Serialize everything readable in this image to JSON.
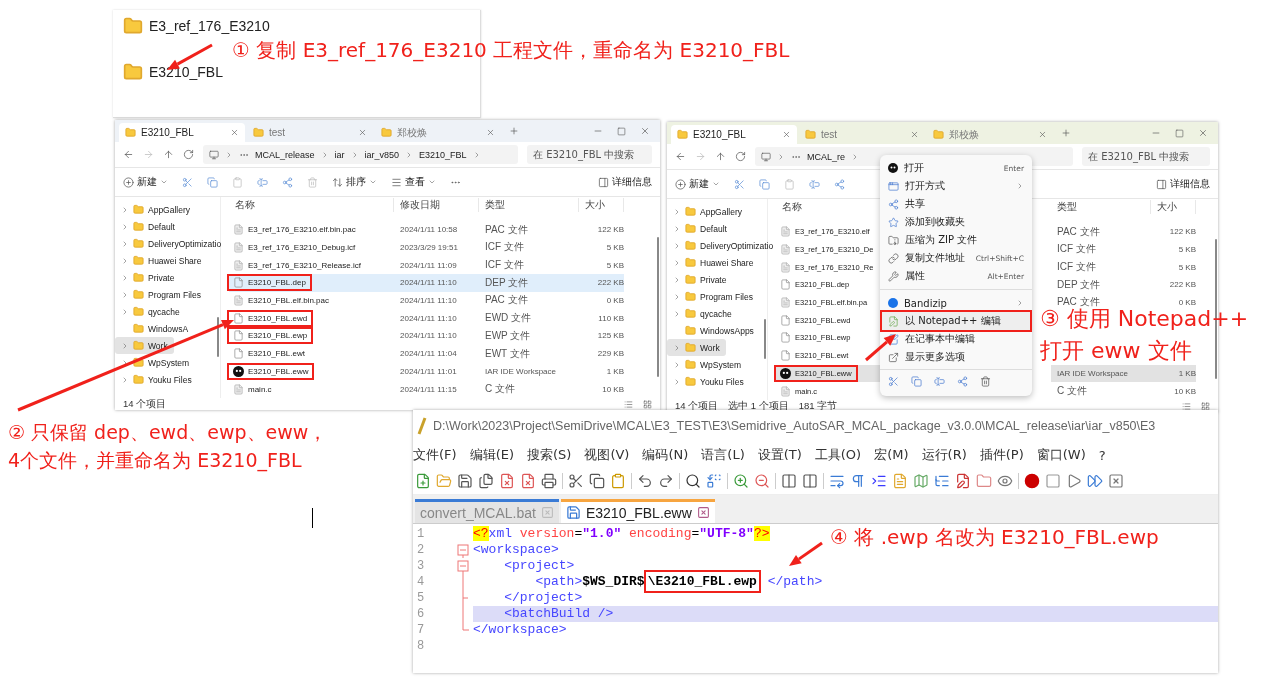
{
  "top_panel": {
    "folders": [
      {
        "name": "E3_ref_176_E3210"
      },
      {
        "name": "E3210_FBL"
      }
    ]
  },
  "annotations": [
    {
      "lines": [
        "① 复制 E3_ref_176_E3210 工程文件，重命名为 E3210_FBL"
      ]
    },
    {
      "lines": [
        "② 只保留 dep、ewd、ewp、eww，",
        "4个文件，并重命名为 E3210_FBL"
      ]
    },
    {
      "lines": [
        "③ 使用 Notepad++",
        "打开 eww 文件"
      ]
    },
    {
      "lines": [
        "④ 将 .ewp 名改为 E3210_FBL.ewp"
      ]
    }
  ],
  "explorers": [
    {
      "tabs": [
        {
          "label": "E3210_FBL",
          "selected": true
        },
        {
          "label": "test",
          "selected": false
        },
        {
          "label": "郑校焕",
          "selected": false
        }
      ],
      "breadcrumb": [
        "MCAL_release",
        "iar",
        "iar_v850",
        "E3210_FBL"
      ],
      "search": {
        "placeholder": "在 E3210_FBL 中搜索"
      },
      "toolbar": [
        {
          "kind": "new",
          "label": "新建"
        },
        {
          "kind": "cut"
        },
        {
          "kind": "copy"
        },
        {
          "kind": "paste"
        },
        {
          "kind": "rename"
        },
        {
          "kind": "share"
        },
        {
          "kind": "delete"
        },
        {
          "kind": "sort",
          "label": "排序"
        },
        {
          "kind": "view",
          "label": "查看"
        },
        {
          "kind": "more"
        }
      ],
      "details": "详细信息",
      "sidebar": [
        {
          "label": "AppGallery",
          "has_children": true,
          "selected": false
        },
        {
          "label": "Default",
          "has_children": true,
          "selected": false
        },
        {
          "label": "DeliveryOptimizatio",
          "has_children": true,
          "selected": false
        },
        {
          "label": "Huawei Share",
          "has_children": true,
          "selected": false
        },
        {
          "label": "Private",
          "has_children": true,
          "selected": false
        },
        {
          "label": "Program Files",
          "has_children": true,
          "selected": false
        },
        {
          "label": "qycache",
          "has_children": true,
          "selected": false
        },
        {
          "label": "WindowsA",
          "has_children": false,
          "selected": false
        },
        {
          "label": "Work",
          "has_children": true,
          "selected": true
        },
        {
          "label": "WpSystem",
          "has_children": true,
          "selected": false
        },
        {
          "label": "Youku Files",
          "has_children": true,
          "selected": false
        }
      ],
      "columns": [
        "名称",
        "修改日期",
        "类型",
        "大小"
      ],
      "files": [
        {
          "name": "E3_ref_176_E3210.elf.bin.pac",
          "date": "2024/1/11 10:58",
          "type": "PAC 文件",
          "size": "122 KB",
          "kind": "generic",
          "selected": false,
          "marked": false
        },
        {
          "name": "E3_ref_176_E3210_Debug.icf",
          "date": "2023/3/29 19:51",
          "type": "ICF 文件",
          "size": "5 KB",
          "kind": "generic",
          "selected": false,
          "marked": false
        },
        {
          "name": "E3_ref_176_E3210_Release.icf",
          "date": "2024/1/11 11:09",
          "type": "ICF 文件",
          "size": "5 KB",
          "kind": "generic",
          "selected": false,
          "marked": false
        },
        {
          "name": "E3210_FBL.dep",
          "date": "2024/1/11 11:10",
          "type": "DEP 文件",
          "size": "222 KB",
          "kind": "document",
          "selected": true,
          "marked": true
        },
        {
          "name": "E3210_FBL.elf.bin.pac",
          "date": "2024/1/11 11:10",
          "type": "PAC 文件",
          "size": "0 KB",
          "kind": "generic",
          "selected": false,
          "marked": false
        },
        {
          "name": "E3210_FBL.ewd",
          "date": "2024/1/11 11:10",
          "type": "EWD 文件",
          "size": "110 KB",
          "kind": "document",
          "selected": false,
          "marked": true
        },
        {
          "name": "E3210_FBL.ewp",
          "date": "2024/1/11 11:10",
          "type": "EWP 文件",
          "size": "125 KB",
          "kind": "document",
          "selected": false,
          "marked": true
        },
        {
          "name": "E3210_FBL.ewt",
          "date": "2024/1/11 11:04",
          "type": "EWT 文件",
          "size": "229 KB",
          "kind": "document",
          "selected": false,
          "marked": false
        },
        {
          "name": "E3210_FBL.eww",
          "date": "2024/1/11 11:01",
          "type": "IAR IDE Workspace",
          "size": "1 KB",
          "kind": "workspace",
          "selected": false,
          "marked": true
        },
        {
          "name": "main.c",
          "date": "2024/1/11 11:15",
          "type": "C 文件",
          "size": "10 KB",
          "kind": "generic",
          "selected": false,
          "marked": false
        }
      ],
      "status": [
        "14 个项目"
      ]
    },
    {
      "tabs": [
        {
          "label": "E3210_FBL",
          "selected": true
        },
        {
          "label": "test",
          "selected": false
        },
        {
          "label": "郑校焕",
          "selected": false
        }
      ],
      "breadcrumb": [
        "MCAL_re"
      ],
      "search": {
        "placeholder": "在 E3210_FBL 中搜索"
      },
      "toolbar": [
        {
          "kind": "new",
          "label": "新建"
        },
        {
          "kind": "cut"
        },
        {
          "kind": "copy"
        },
        {
          "kind": "paste"
        },
        {
          "kind": "rename"
        },
        {
          "kind": "share"
        }
      ],
      "details": "详细信息",
      "sidebar": [
        {
          "label": "AppGallery",
          "has_children": true,
          "selected": false
        },
        {
          "label": "Default",
          "has_children": true,
          "selected": false
        },
        {
          "label": "DeliveryOptimizatio",
          "has_children": true,
          "selected": false
        },
        {
          "label": "Huawei Share",
          "has_children": true,
          "selected": false
        },
        {
          "label": "Private",
          "has_children": true,
          "selected": false
        },
        {
          "label": "Program Files",
          "has_children": true,
          "selected": false
        },
        {
          "label": "qycache",
          "has_children": true,
          "selected": false
        },
        {
          "label": "WindowsApps",
          "has_children": false,
          "selected": false
        },
        {
          "label": "Work",
          "has_children": true,
          "selected": true
        },
        {
          "label": "WpSystem",
          "has_children": true,
          "selected": false
        },
        {
          "label": "Youku Files",
          "has_children": true,
          "selected": false
        }
      ],
      "columns": [
        "名称",
        "类型",
        "大小"
      ],
      "files": [
        {
          "name": "E3_ref_176_E3210.elf",
          "type": "PAC 文件",
          "size": "122 KB",
          "kind": "generic",
          "selected": false,
          "marked": false
        },
        {
          "name": "E3_ref_176_E3210_De",
          "type": "ICF 文件",
          "size": "5 KB",
          "kind": "generic",
          "selected": false,
          "marked": false
        },
        {
          "name": "E3_ref_176_E3210_Re",
          "type": "ICF 文件",
          "size": "5 KB",
          "kind": "generic",
          "selected": false,
          "marked": false
        },
        {
          "name": "E3210_FBL.dep",
          "type": "DEP 文件",
          "size": "222 KB",
          "kind": "document",
          "selected": false,
          "marked": false
        },
        {
          "name": "E3210_FBL.elf.bin.pa",
          "type": "PAC 文件",
          "size": "0 KB",
          "kind": "generic",
          "selected": false,
          "marked": false
        },
        {
          "name": "E3210_FBL.ewd",
          "kind": "document",
          "selected": false,
          "marked": false
        },
        {
          "name": "E3210_FBL.ewp",
          "kind": "document",
          "selected": false,
          "marked": false
        },
        {
          "name": "E3210_FBL.ewt",
          "kind": "document",
          "selected": false,
          "marked": false
        },
        {
          "name": "E3210_FBL.eww",
          "type": "IAR IDE Workspace",
          "size": "1 KB",
          "kind": "workspace",
          "selected": true,
          "marked": true
        },
        {
          "name": "main.c",
          "type": "C 文件",
          "size": "10 KB",
          "kind": "generic",
          "selected": false,
          "marked": false
        }
      ],
      "status": [
        "14 个项目",
        "选中 1 个项目",
        "181 字节"
      ],
      "context_menu": {
        "items": [
          {
            "kind": "item",
            "label": "打开",
            "shortcut": "Enter",
            "submenu": false,
            "marked": false
          },
          {
            "kind": "item",
            "label": "打开方式",
            "submenu": true,
            "marked": false
          },
          {
            "kind": "item",
            "label": "共享",
            "submenu": false,
            "marked": false
          },
          {
            "kind": "item",
            "label": "添加到收藏夹",
            "submenu": false,
            "marked": false
          },
          {
            "kind": "item",
            "label": "压缩为 ZIP 文件",
            "submenu": false,
            "marked": false
          },
          {
            "kind": "item",
            "label": "复制文件地址",
            "shortcut": "Ctrl+Shift+C",
            "submenu": false,
            "marked": false
          },
          {
            "kind": "item",
            "label": "属性",
            "shortcut": "Alt+Enter",
            "submenu": false,
            "marked": false
          },
          {
            "kind": "separator"
          },
          {
            "kind": "item",
            "label": "Bandizip",
            "submenu": true,
            "marked": false
          },
          {
            "kind": "item",
            "label": "以 Notepad++ 编辑",
            "submenu": false,
            "marked": true
          },
          {
            "kind": "item",
            "label": "在记事本中编辑",
            "submenu": false,
            "marked": false
          },
          {
            "kind": "item",
            "label": "显示更多选项",
            "submenu": false,
            "marked": false
          },
          {
            "kind": "icon_row"
          }
        ]
      }
    }
  ],
  "editor": {
    "title": "D:\\Work\\2023\\Project\\SemiDrive\\MCAL\\E3_TEST\\E3\\Semidrive_AutoSAR_MCAL_package_v3.0.0\\MCAL_release\\iar\\iar_v850\\E3",
    "menu": [
      "文件(F)",
      "编辑(E)",
      "搜索(S)",
      "视图(V)",
      "编码(N)",
      "语言(L)",
      "设置(T)",
      "工具(O)",
      "宏(M)",
      "运行(R)",
      "插件(P)",
      "窗口(W)",
      "?"
    ],
    "tabs": [
      {
        "label": "convert_MCAL.bat",
        "selected": false
      },
      {
        "label": "E3210_FBL.eww",
        "selected": true
      }
    ],
    "lines": [
      {
        "number": "1",
        "kind": "plain",
        "current": false,
        "tokens": [
          {
            "kind": "pi",
            "text": "<?"
          },
          {
            "kind": "tag",
            "text": "xml"
          },
          {
            "kind": "attr",
            "text": " version"
          },
          {
            "kind": "plain",
            "text": "="
          },
          {
            "kind": "string",
            "text": "\"1.0\""
          },
          {
            "kind": "attr",
            "text": " encoding"
          },
          {
            "kind": "plain",
            "text": "="
          },
          {
            "kind": "string",
            "text": "\"UTF-8\""
          },
          {
            "kind": "pi",
            "text": "?>"
          }
        ]
      },
      {
        "number": "2",
        "kind": "fold_open",
        "current": false,
        "tokens": [
          {
            "kind": "tag",
            "text": "<workspace>"
          }
        ]
      },
      {
        "number": "3",
        "kind": "fold_open",
        "current": false,
        "tokens": [
          {
            "kind": "tag",
            "text": "<project>"
          }
        ]
      },
      {
        "number": "4",
        "kind": "fold_body",
        "current": false,
        "tokens": [
          {
            "kind": "tag",
            "text": "<path>"
          },
          {
            "kind": "text",
            "text": "$WS_DIR$"
          },
          {
            "kind": "boxed",
            "text": "\\E3210_FBL.ewp"
          },
          {
            "kind": "tag",
            "text": " </path>"
          }
        ]
      },
      {
        "number": "5",
        "kind": "fold_close",
        "current": false,
        "tokens": [
          {
            "kind": "tag",
            "text": "</project>"
          }
        ]
      },
      {
        "number": "6",
        "kind": "fold_body",
        "current": true,
        "tokens": [
          {
            "kind": "tag",
            "text": "<batchBuild />"
          }
        ]
      },
      {
        "number": "7",
        "kind": "fold_end",
        "current": false,
        "tokens": [
          {
            "kind": "tag",
            "text": "</workspace>"
          }
        ]
      },
      {
        "number": "8",
        "kind": "plain",
        "current": false
      }
    ]
  }
}
